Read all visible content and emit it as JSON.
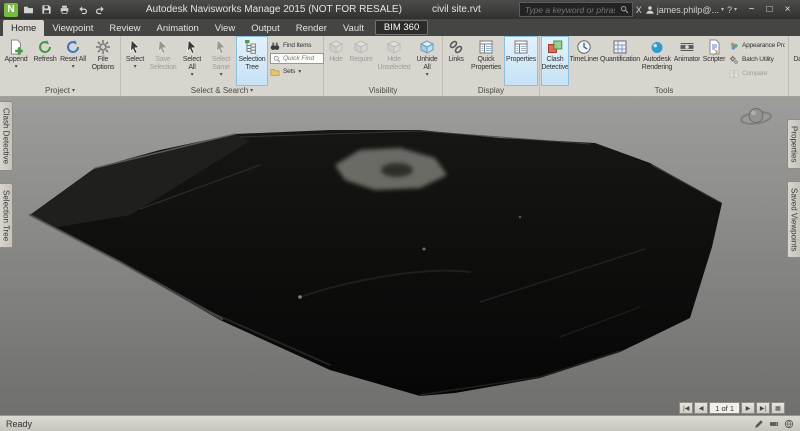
{
  "colors": {
    "logo_green": "#76b943",
    "active_highlight_bg": "#c6e2f6",
    "active_highlight_border": "#8cbfe2",
    "titlebar_bg": "#3a3a38",
    "ribbon_bg": "#d8d5ce",
    "viewport_top": "#9d9d9b",
    "viewport_bottom": "#6f6f6d",
    "terrain_black": "#0c0c0a"
  },
  "glyphs": {
    "dropdown": "▾"
  },
  "titlebar": {
    "logo_letter": "N",
    "qat_icons": [
      "navisworks-logo",
      "open-icon",
      "save-icon",
      "print-icon",
      "undo-icon",
      "redo-icon"
    ],
    "app_title": "Autodesk Navisworks Manage 2015 (NOT FOR RESALE)",
    "doc_title": "civil site.rvt",
    "search": {
      "placeholder": "Type a keyword or phrase"
    },
    "exchange_label": "X",
    "account": "james.philp@...",
    "help_label": "?",
    "window": {
      "minimize": "−",
      "maximize": "□",
      "close": "×"
    }
  },
  "ribbon": {
    "tabs": [
      {
        "label": "Home",
        "active": true
      },
      {
        "label": "Viewpoint"
      },
      {
        "label": "Review"
      },
      {
        "label": "Animation"
      },
      {
        "label": "View"
      },
      {
        "label": "Output"
      },
      {
        "label": "Render"
      },
      {
        "label": "Vault"
      },
      {
        "label": "BIM 360",
        "dark": true
      }
    ],
    "panels": [
      {
        "caption": "Project",
        "flyout": true,
        "buttons": [
          {
            "label": "Append",
            "icon": "append-icon",
            "arrow": true
          },
          {
            "label": "Refresh",
            "icon": "refresh-icon"
          },
          {
            "label": "Reset All",
            "icon": "reset-icon",
            "arrow": true
          },
          {
            "label": "File Options",
            "icon": "gear-icon"
          }
        ]
      },
      {
        "caption": "Select & Search",
        "flyout": true,
        "buttons": [
          {
            "label": "Select",
            "icon": "cursor-icon",
            "arrow": true
          },
          {
            "label": "Save Selection",
            "icon": "cursor-icon",
            "disabled": true
          },
          {
            "label": "Select All",
            "icon": "cursor-icon",
            "arrow": true
          },
          {
            "label": "Select Same",
            "icon": "cursor-icon",
            "arrow": true,
            "disabled": true
          },
          {
            "label": "Selection Tree",
            "icon": "tree-icon",
            "active": true
          },
          {
            "label": "Find Items",
            "icon": "binoculars-icon"
          },
          {
            "label": "Quick Find",
            "icon": "magnifier-icon"
          },
          {
            "label": "Sets",
            "icon": "folder-icon",
            "arrow": true
          }
        ]
      },
      {
        "caption": "Visibility",
        "buttons": [
          {
            "label": "Hide",
            "icon": "cube-icon",
            "disabled": true
          },
          {
            "label": "Require",
            "icon": "cube-icon",
            "disabled": true
          },
          {
            "label": "Hide Unselected",
            "icon": "cube-icon",
            "disabled": true
          },
          {
            "label": "Unhide All",
            "icon": "cube-icon",
            "arrow": true
          }
        ]
      },
      {
        "caption": "Display",
        "buttons": [
          {
            "label": "Links",
            "icon": "chain-icon"
          },
          {
            "label": "Quick Properties",
            "icon": "properties-icon"
          },
          {
            "label": "Properties",
            "icon": "properties-icon",
            "active": true
          }
        ]
      },
      {
        "caption": "Tools",
        "buttons": [
          {
            "label": "Clash Detective",
            "icon": "clash-icon",
            "active": true
          },
          {
            "label": "TimeLiner",
            "icon": "clock-icon"
          },
          {
            "label": "Quantification",
            "icon": "quantification-icon"
          },
          {
            "label": "Autodesk Rendering",
            "icon": "render-icon"
          },
          {
            "label": "Animator",
            "icon": "film-icon"
          },
          {
            "label": "Scripter",
            "icon": "script-icon"
          },
          {
            "label": "Appearance Profiler",
            "icon": "palette-icon"
          },
          {
            "label": "Batch Utility",
            "icon": "gears-icon"
          },
          {
            "label": "Compare",
            "icon": "compare-icon",
            "disabled": true
          }
        ]
      },
      {
        "caption": "",
        "buttons": [
          {
            "label": "DataTools",
            "icon": "database-icon"
          }
        ]
      }
    ]
  },
  "dock": {
    "left_tabs": [
      "Clash Detective",
      "Selection Tree"
    ],
    "right_tabs": [
      "Properties",
      "Saved Viewpoints"
    ]
  },
  "viewport": {
    "nav": {
      "first": "|◀",
      "prev": "◀",
      "label": "1 of 1",
      "next": "▶",
      "last": "▶|",
      "browser": "▦"
    }
  },
  "statusbar": {
    "ready": "Ready",
    "indicator_icons": [
      "pencil-icon",
      "disk-icon",
      "web-icon"
    ]
  }
}
